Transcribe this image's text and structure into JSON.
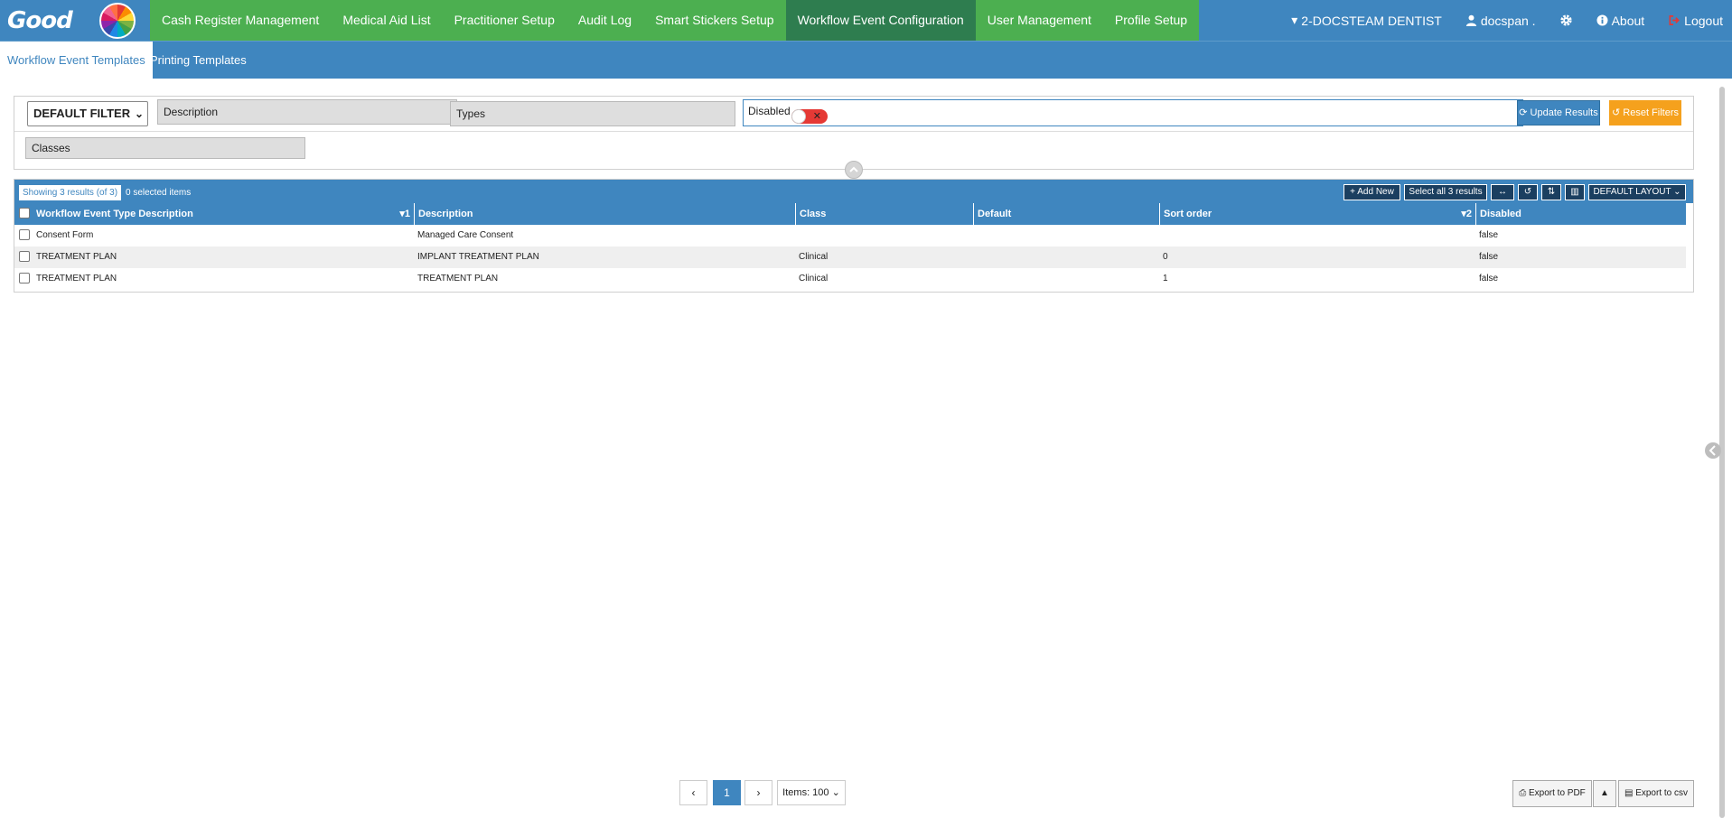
{
  "logo": {
    "text": "Good"
  },
  "topnav": {
    "items": [
      "Cash Register Management",
      "Medical Aid List",
      "Practitioner Setup",
      "Audit Log",
      "Smart Stickers Setup",
      "Workflow Event Configuration",
      "User Management",
      "Profile Setup"
    ],
    "active_index": 5
  },
  "rightnav": {
    "practice": "2-DOCSTEAM DENTIST",
    "user": "docspan .",
    "about": "About",
    "logout": "Logout"
  },
  "subnav": {
    "tabs": [
      "Workflow Event Templates",
      "Printing Templates"
    ]
  },
  "filters": {
    "preset": "DEFAULT FILTER",
    "description_label": "Description",
    "types_label": "Types",
    "disabled_label": "Disabled",
    "classes_label": "Classes",
    "update_button": "Update Results",
    "reset_button": "Reset Filters"
  },
  "grid": {
    "showing": "Showing 3 results (of 3)",
    "selected": "0 selected items",
    "add_new": "Add New",
    "select_all": "Select all 3 results",
    "layout": "DEFAULT LAYOUT",
    "columns": [
      "Workflow Event Type Description",
      "Description",
      "Class",
      "Default",
      "Sort order",
      "Disabled"
    ],
    "sort_marks": {
      "col0": "1",
      "col4": "2"
    },
    "rows": [
      {
        "type_desc": "Consent Form",
        "description": "Managed Care Consent",
        "class": "",
        "default": "",
        "sort_order": "",
        "disabled": "false"
      },
      {
        "type_desc": "TREATMENT PLAN",
        "description": "IMPLANT TREATMENT PLAN",
        "class": "Clinical",
        "default": "",
        "sort_order": "0",
        "disabled": "false"
      },
      {
        "type_desc": "TREATMENT PLAN",
        "description": "TREATMENT PLAN",
        "class": "Clinical",
        "default": "",
        "sort_order": "1",
        "disabled": "false"
      }
    ]
  },
  "pagination": {
    "page": "1",
    "items": "Items: 100"
  },
  "export": {
    "pdf": "Export to PDF",
    "csv": "Export to csv"
  },
  "colors": {
    "primary": "#3f86bf",
    "green": "#4caf50",
    "active_green": "#2e7d4f",
    "orange": "#f5a11d",
    "toggle_red": "#e53935"
  }
}
